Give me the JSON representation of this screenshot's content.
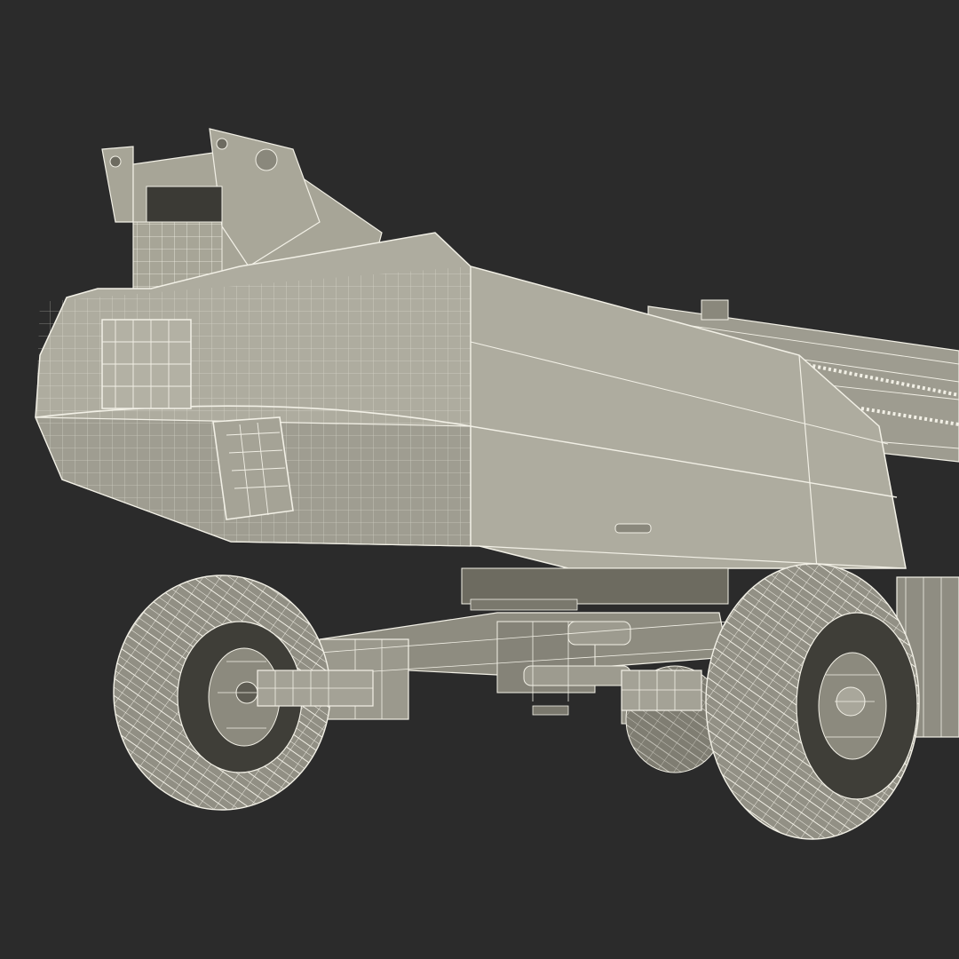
{
  "render": {
    "background_color": "#2b2b2b",
    "surface_color": "#a7a597",
    "surface_shadow_color": "#6d6b60",
    "surface_dark_color": "#4f4e46",
    "wire_color": "#f2f0e6",
    "tire_color": "#8f8d82"
  }
}
